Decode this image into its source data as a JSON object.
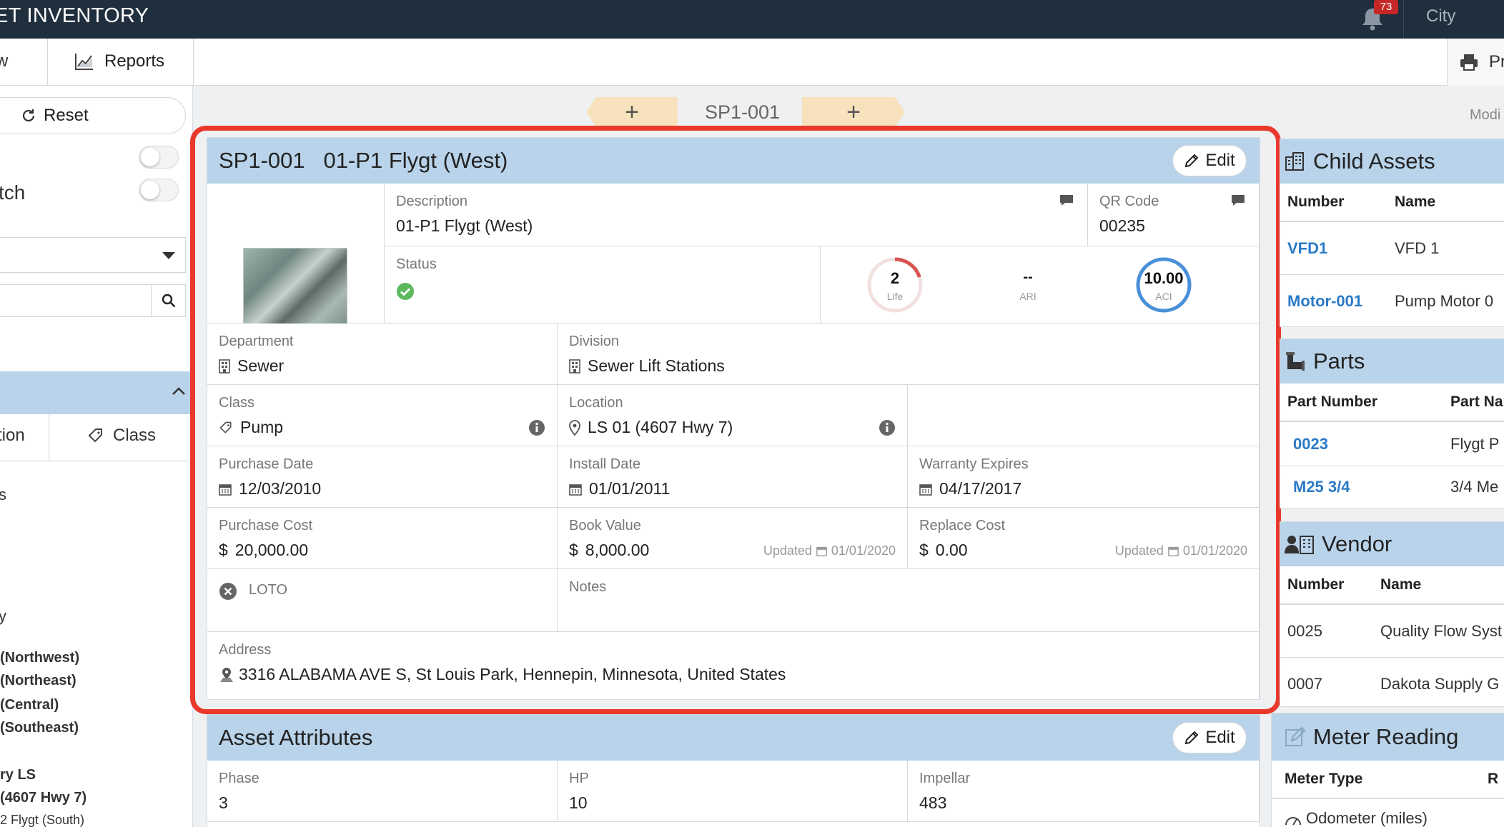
{
  "app": {
    "title": "ET INVENTORY",
    "notification_count": "73",
    "city": "City"
  },
  "toolbar": {
    "cut_label": "w",
    "reports_label": "Reports",
    "print_label": "Pri"
  },
  "filters": {
    "reset_label": "Reset",
    "tch_label": "tch",
    "tabs": {
      "location_label": "tion",
      "class_label": "Class"
    },
    "s_label": "s",
    "y_label": "y",
    "tree_items": [
      "(Northwest)",
      "(Northeast)",
      "(Central)",
      "(Southeast)",
      "ry LS",
      "(4607 Hwy 7)",
      "2 Flygt (South)"
    ]
  },
  "breadcrumb": {
    "current": "SP1-001",
    "add_symbol": "+",
    "modified_label": "Modi"
  },
  "asset": {
    "number": "SP1-001",
    "name": "01-P1 Flygt (West)",
    "edit_label": "Edit",
    "description": {
      "label": "Description",
      "value": "01-P1 Flygt (West)"
    },
    "qr_code": {
      "label": "QR Code",
      "value": "00235"
    },
    "status": {
      "label": "Status"
    },
    "gauges": {
      "life": {
        "value": "2",
        "label": "Life",
        "fraction": 0.2,
        "color": "#d9534f"
      },
      "ari": {
        "value": "--",
        "label": "ARI"
      },
      "aci": {
        "value": "10.00",
        "label": "ACI",
        "fraction": 1.0,
        "color": "#4a90d9"
      }
    },
    "department": {
      "label": "Department",
      "value": "Sewer"
    },
    "division": {
      "label": "Division",
      "value": "Sewer Lift Stations"
    },
    "class": {
      "label": "Class",
      "value": "Pump"
    },
    "location": {
      "label": "Location",
      "value": "LS 01 (4607 Hwy 7)"
    },
    "purchase_date": {
      "label": "Purchase Date",
      "value": "12/03/2010"
    },
    "install_date": {
      "label": "Install Date",
      "value": "01/01/2011"
    },
    "warranty_expires": {
      "label": "Warranty Expires",
      "value": "04/17/2017"
    },
    "purchase_cost": {
      "label": "Purchase Cost",
      "value": "20,000.00"
    },
    "book_value": {
      "label": "Book Value",
      "value": "8,000.00",
      "updated_label": "Updated",
      "updated_date": "01/01/2020"
    },
    "replace_cost": {
      "label": "Replace Cost",
      "value": "0.00",
      "updated_label": "Updated",
      "updated_date": "01/01/2020"
    },
    "currency": "$",
    "loto": {
      "label": "LOTO"
    },
    "notes": {
      "label": "Notes"
    },
    "address": {
      "label": "Address",
      "value": "3316 ALABAMA AVE S, St Louis Park, Hennepin, Minnesota, United States"
    }
  },
  "attributes": {
    "title": "Asset Attributes",
    "edit_label": "Edit",
    "fields": [
      {
        "label": "Phase",
        "value": "3"
      },
      {
        "label": "HP",
        "value": "10"
      },
      {
        "label": "Impellar",
        "value": "483"
      }
    ]
  },
  "child_assets": {
    "title": "Child Assets",
    "columns": [
      "Number",
      "Name"
    ],
    "rows": [
      {
        "number": "VFD1",
        "name": "VFD 1"
      },
      {
        "number": "Motor-001",
        "name": "Pump Motor 0"
      }
    ]
  },
  "parts": {
    "title": "Parts",
    "columns": [
      "Part Number",
      "Part Na"
    ],
    "rows": [
      {
        "number": "0023",
        "name": "Flygt P"
      },
      {
        "number": "M25 3/4",
        "name": "3/4 Me"
      }
    ]
  },
  "vendor": {
    "title": "Vendor",
    "columns": [
      "Number",
      "Name"
    ],
    "rows": [
      {
        "number": "0025",
        "name": "Quality Flow Syst"
      },
      {
        "number": "0007",
        "name": "Dakota Supply G"
      }
    ]
  },
  "meter_reading": {
    "title": "Meter Reading",
    "columns": [
      "Meter Type",
      "R"
    ],
    "rows": [
      {
        "type": "Odometer (miles)"
      }
    ]
  },
  "colors": {
    "header_blue": "#b9d3ea",
    "topbar": "#1f2f3d",
    "highlight": "#e8392c",
    "link": "#2b7ac7",
    "status_ok": "#5cb85c"
  }
}
